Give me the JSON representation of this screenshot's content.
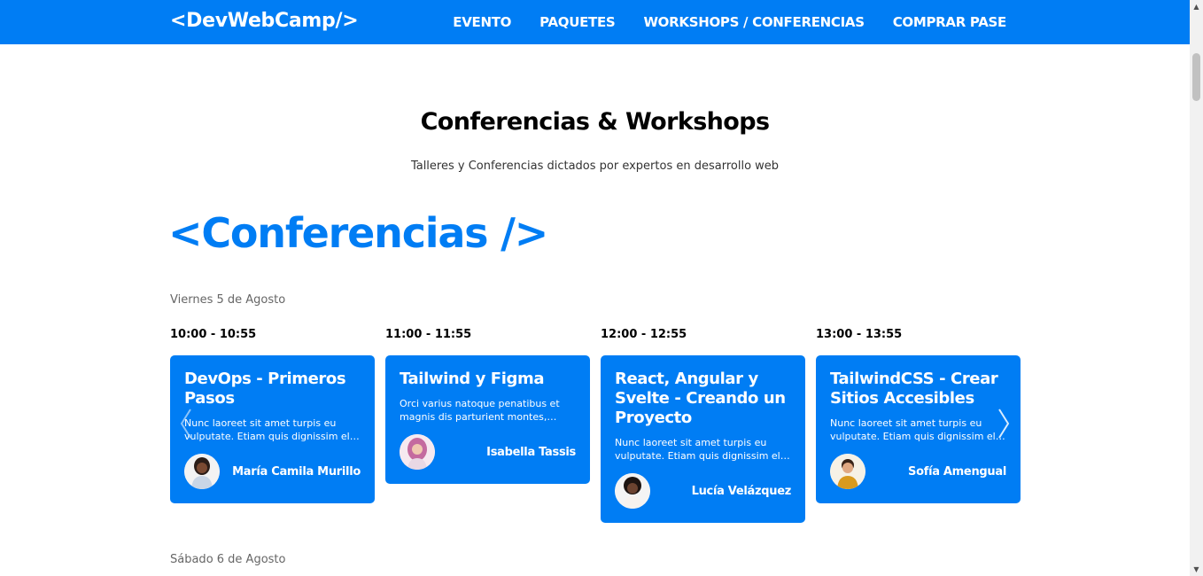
{
  "header": {
    "logo": "<DevWebCamp/>",
    "nav": [
      {
        "label": "EVENTO"
      },
      {
        "label": "PAQUETES"
      },
      {
        "label": "WORKSHOPS / CONFERENCIAS"
      },
      {
        "label": "COMPRAR PASE"
      }
    ]
  },
  "main": {
    "title": "Conferencias & Workshops",
    "subtitle": "Talleres y Conferencias dictados por expertos en desarrollo web",
    "section_title": "<Conferencias />",
    "day1": "Viernes 5 de Agosto",
    "day2": "Sábado 6 de Agosto",
    "events": [
      {
        "time": "10:00 - 10:55",
        "title": "DevOps - Primeros Pasos",
        "desc": "Nunc laoreet sit amet turpis eu vulputate. Etiam quis dignissim elit, eget posuere sem.",
        "speaker": "María Camila Murillo"
      },
      {
        "time": "11:00 - 11:55",
        "title": "Tailwind y Figma",
        "desc": "Orci varius natoque penatibus et magnis dis parturient montes, nascetur ridiculus mus.",
        "speaker": "Isabella Tassis"
      },
      {
        "time": "12:00 - 12:55",
        "title": "React, Angular y Svelte - Creando un Proyecto",
        "desc": "Nunc laoreet sit amet turpis eu vulputate. Etiam quis dignissim elit, eget posuere sem.",
        "speaker": "Lucía Velázquez"
      },
      {
        "time": "13:00 - 13:55",
        "title": "TailwindCSS - Crear Sitios Accesibles",
        "desc": "Nunc laoreet sit amet turpis eu vulputate. Etiam quis dignissim elit, eget posuere sem.",
        "speaker": "Sofía Amengual"
      }
    ]
  },
  "colors": {
    "accent": "#007df4",
    "background": "#ffffff"
  }
}
